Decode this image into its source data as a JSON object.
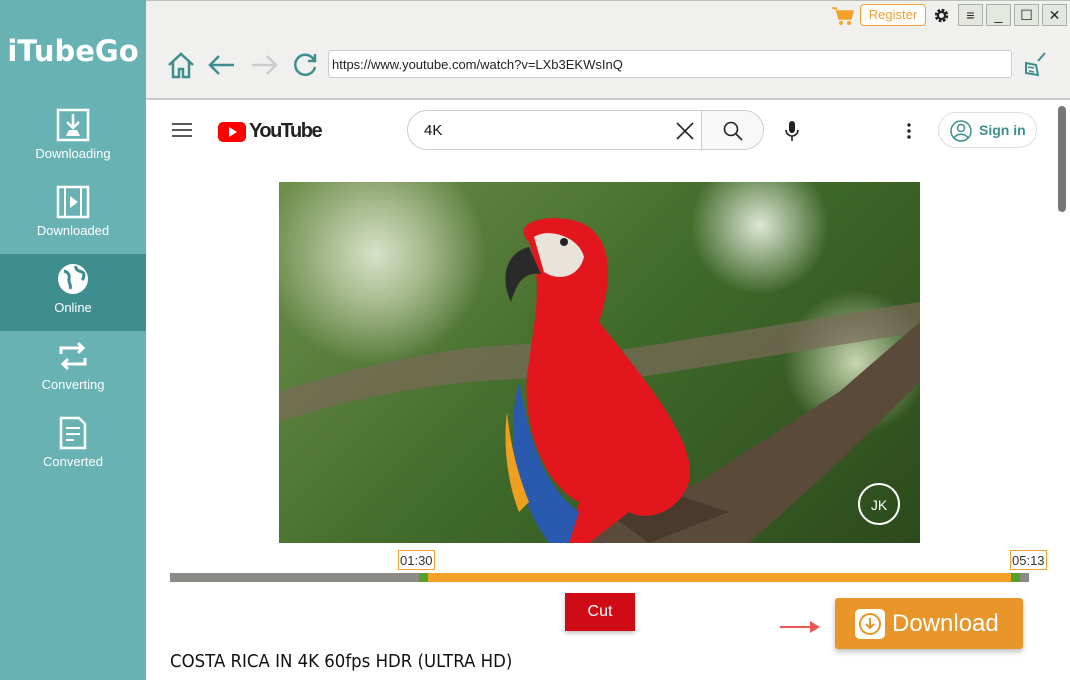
{
  "app": {
    "name": "iTubeGo"
  },
  "sidebar": {
    "items": [
      {
        "label": "Downloading",
        "icon": "download-icon"
      },
      {
        "label": "Downloaded",
        "icon": "film-icon"
      },
      {
        "label": "Online",
        "icon": "globe-icon",
        "active": true
      },
      {
        "label": "Converting",
        "icon": "convert-icon"
      },
      {
        "label": "Converted",
        "icon": "document-icon"
      }
    ]
  },
  "toolbar": {
    "url": "https://www.youtube.com/watch?v=LXb3EKWsInQ",
    "register_label": "Register"
  },
  "youtube": {
    "logo": "YouTube",
    "search_value": "4K",
    "sign_in_label": "Sign in"
  },
  "video": {
    "watermark": "JK",
    "start_time": "01:30",
    "end_time": "05:13",
    "selected_start_fraction": 0.29,
    "selected_end_fraction": 0.99,
    "title": "COSTA RICA IN 4K 60fps HDR (ULTRA HD)"
  },
  "actions": {
    "cut_label": "Cut",
    "download_label": "Download"
  },
  "colors": {
    "sidebar": "#68b2b4",
    "sidebar_active": "#3e8e8f",
    "accent": "#e8952a",
    "cut": "#cf0c16",
    "range": "#f5a026"
  }
}
